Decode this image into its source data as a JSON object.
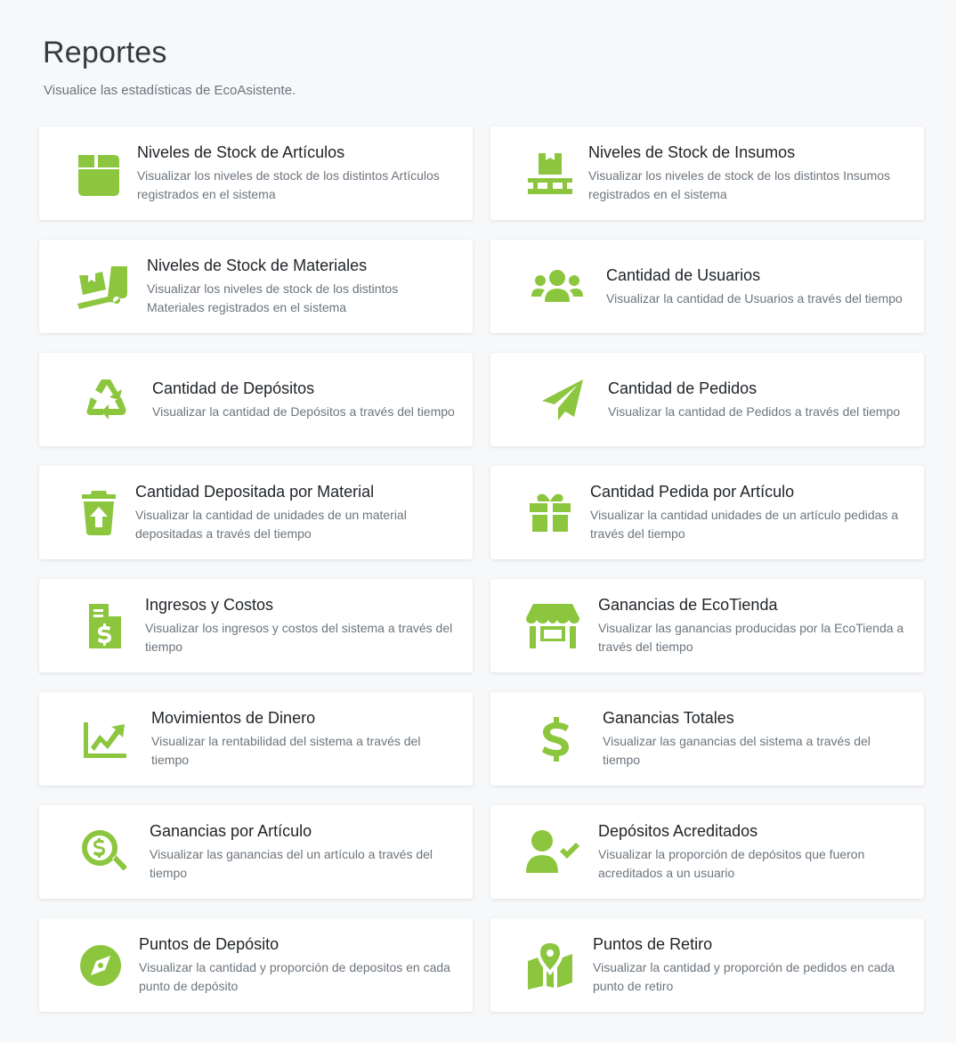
{
  "page": {
    "title": "Reportes",
    "subtitle": "Visualice las estadísticas de EcoAsistente."
  },
  "accent_color": "#8cc63f",
  "reports": [
    {
      "icon": "box-icon",
      "title": "Niveles de Stock de Artículos",
      "description": "Visualizar los niveles de stock de los distintos Artículos registrados en el sistema"
    },
    {
      "icon": "pallet-icon",
      "title": "Niveles de Stock de Insumos",
      "description": "Visualizar los niveles de stock de los distintos Insumos registrados en el sistema"
    },
    {
      "icon": "dolly-icon",
      "title": "Niveles de Stock de Materiales",
      "description": "Visualizar los niveles de stock de los distintos Materiales registrados en el sistema"
    },
    {
      "icon": "users-icon",
      "title": "Cantidad de Usuarios",
      "description": "Visualizar la cantidad de Usuarios a través del tiempo"
    },
    {
      "icon": "recycle-icon",
      "title": "Cantidad de Depósitos",
      "description": "Visualizar la cantidad de Depósitos a través del tiempo"
    },
    {
      "icon": "paper-plane-icon",
      "title": "Cantidad de Pedidos",
      "description": "Visualizar la cantidad de Pedidos a través del tiempo"
    },
    {
      "icon": "trash-arrow-up-icon",
      "title": "Cantidad Depositada por Material",
      "description": "Visualizar la cantidad de unidades de un material depositadas a través del tiempo"
    },
    {
      "icon": "gift-icon",
      "title": "Cantidad Pedida por Artículo",
      "description": "Visualizar la cantidad unidades de un artículo pedidas a través del tiempo"
    },
    {
      "icon": "invoice-dollar-icon",
      "title": "Ingresos y Costos",
      "description": "Visualizar los ingresos y costos del sistema a través del tiempo"
    },
    {
      "icon": "store-icon",
      "title": "Ganancias de EcoTienda",
      "description": "Visualizar las ganancias producidas por la EcoTienda a través del tiempo"
    },
    {
      "icon": "chart-line-icon",
      "title": "Movimientos de Dinero",
      "description": "Visualizar la rentabilidad del sistema a través del tiempo"
    },
    {
      "icon": "dollar-sign-icon",
      "title": "Ganancias Totales",
      "description": "Visualizar las ganancias del sistema a través del tiempo"
    },
    {
      "icon": "search-dollar-icon",
      "title": "Ganancias por Artículo",
      "description": "Visualizar las ganancias del un artículo a través del tiempo"
    },
    {
      "icon": "user-check-icon",
      "title": "Depósitos Acreditados",
      "description": "Visualizar la proporción de depósitos que fueron acreditados a un usuario"
    },
    {
      "icon": "compass-icon",
      "title": "Puntos de Depósito",
      "description": "Visualizar la cantidad y proporción de depositos en cada punto de depósito"
    },
    {
      "icon": "map-marked-icon",
      "title": "Puntos de Retiro",
      "description": "Visualizar la cantidad y proporción de pedidos en cada punto de retiro"
    }
  ]
}
